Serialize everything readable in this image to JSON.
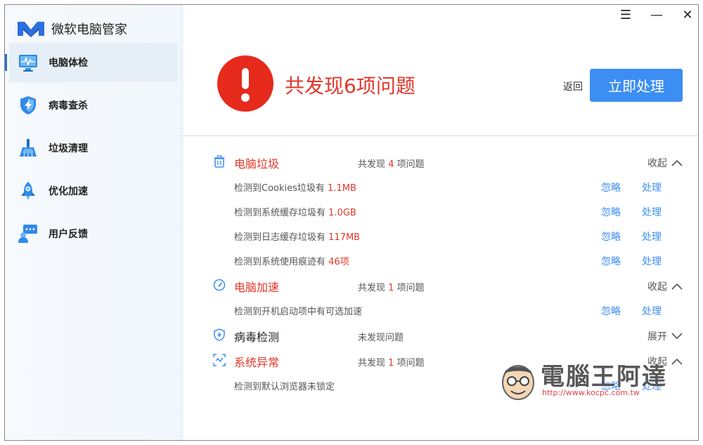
{
  "app": {
    "title": "微软电脑管家",
    "brand_color": "#2b6fe0",
    "logo_icon": "m-logo-icon"
  },
  "window_controls": {
    "menu": "☰",
    "minimize": "—",
    "close": "✕"
  },
  "sidebar": {
    "items": [
      {
        "label": "电脑体检",
        "icon": "monitor-pulse-icon",
        "active": true
      },
      {
        "label": "病毒查杀",
        "icon": "shield-bolt-icon",
        "active": false
      },
      {
        "label": "垃圾清理",
        "icon": "broom-icon",
        "active": false
      },
      {
        "label": "优化加速",
        "icon": "rocket-icon",
        "active": false
      },
      {
        "label": "用户反馈",
        "icon": "chat-user-icon",
        "active": false
      }
    ]
  },
  "header": {
    "headline": "共发现6项问题",
    "alert_icon": "exclamation-icon",
    "back_label": "返回",
    "primary_label": "立即处理",
    "alert_color": "#e62a1c",
    "primary_color": "#3c8ef2"
  },
  "groups": [
    {
      "title": "电脑垃圾",
      "icon": "trash-icon",
      "count_prefix": "共发现",
      "count_num": "4",
      "count_suffix": "项问题",
      "toggle": "收起",
      "rows": [
        {
          "text": "检测到Cookies垃圾有",
          "value": "1.1MB"
        },
        {
          "text": "检测到系统缓存垃圾有",
          "value": "1.0GB"
        },
        {
          "text": "检测到日志缓存垃圾有",
          "value": "117MB"
        },
        {
          "text": "检测到系统使用痕迹有",
          "value": "46项"
        }
      ]
    },
    {
      "title": "电脑加速",
      "icon": "speedometer-icon",
      "count_prefix": "共发现",
      "count_num": "1",
      "count_suffix": "项问题",
      "toggle": "收起",
      "rows": [
        {
          "text": "检测到开机启动项中有可选加速",
          "value": ""
        }
      ]
    },
    {
      "title": "病毒检测",
      "icon": "shield-bolt-icon",
      "status": "未发现问题",
      "toggle": "展开",
      "rows": []
    },
    {
      "title": "系统异常",
      "icon": "scan-frame-icon",
      "count_prefix": "共发现",
      "count_num": "1",
      "count_suffix": "项问题",
      "toggle": "收起",
      "rows": [
        {
          "text": "检测到默认浏览器未锁定",
          "value": ""
        }
      ]
    }
  ],
  "row_actions": {
    "ignore": "忽略",
    "handle": "处理"
  },
  "watermark": {
    "text": "電腦王阿達",
    "url": "http://www.kocpc.com.tw"
  }
}
